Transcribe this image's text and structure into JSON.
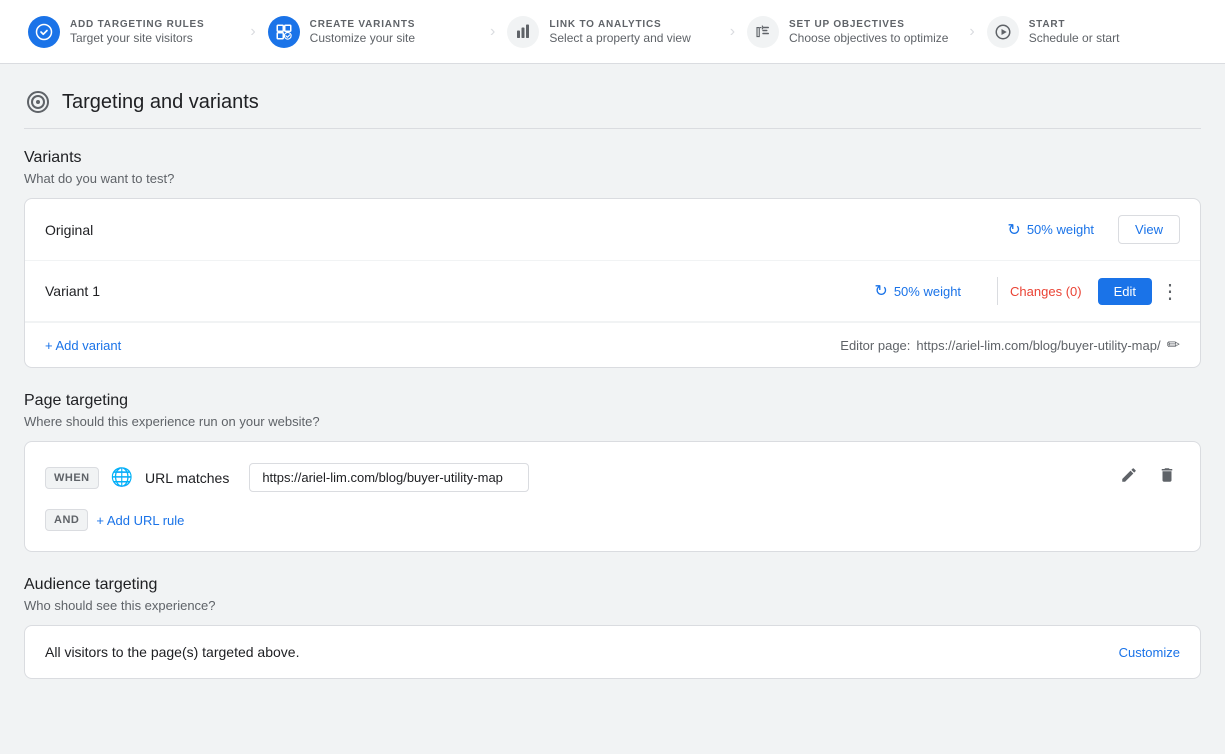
{
  "nav": {
    "steps": [
      {
        "id": "add-targeting",
        "label": "ADD TARGETING RULES",
        "desc": "Target your site visitors",
        "state": "completed"
      },
      {
        "id": "create-variants",
        "label": "CREATE VARIANTS",
        "desc": "Customize your site",
        "state": "completed"
      },
      {
        "id": "link-analytics",
        "label": "LINK TO ANALYTICS",
        "desc": "Select a property and view",
        "state": "active"
      },
      {
        "id": "setup-objectives",
        "label": "SET UP OBJECTIVES",
        "desc": "Choose objectives to optimize",
        "state": "inactive"
      },
      {
        "id": "start",
        "label": "START",
        "desc": "Schedule or start",
        "state": "inactive"
      }
    ]
  },
  "page": {
    "title": "Targeting and variants",
    "sections": {
      "variants": {
        "heading": "Variants",
        "subtext": "What do you want to test?",
        "rows": [
          {
            "name": "Original",
            "weight": "50% weight",
            "action": "View"
          },
          {
            "name": "Variant 1",
            "weight": "50% weight",
            "changes": "Changes (0)",
            "action": "Edit"
          }
        ],
        "add_label": "+ Add variant",
        "editor_page_prefix": "Editor page:",
        "editor_page_url": "https://ariel-lim.com/blog/buyer-utility-map/"
      },
      "page_targeting": {
        "heading": "Page targeting",
        "subtext": "Where should this experience run on your website?",
        "when_label": "WHEN",
        "and_label": "AND",
        "url_matches_label": "URL matches",
        "url_value": "https://ariel-lim.com/blog/buyer-utility-map",
        "add_url_label": "+ Add URL rule"
      },
      "audience_targeting": {
        "heading": "Audience targeting",
        "subtext": "Who should see this experience?",
        "audience_text": "All visitors to the page(s) targeted above.",
        "customize_label": "Customize"
      }
    }
  }
}
